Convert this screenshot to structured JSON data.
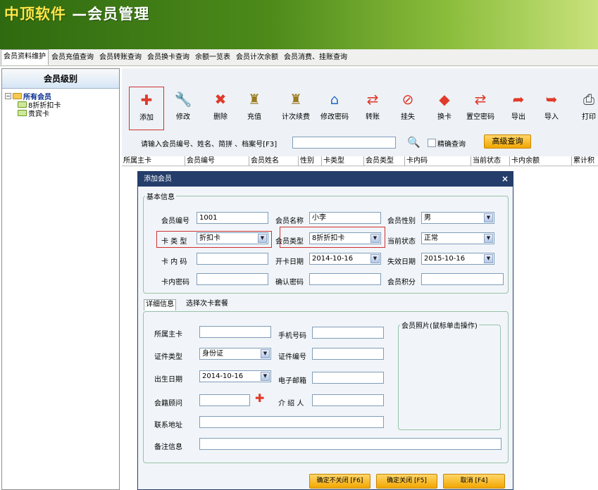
{
  "app": {
    "brand": "中顶软件",
    "subtitle": " —会员管理"
  },
  "tabs": [
    "会员资料维护",
    "会员充值查询",
    "会员转账查询",
    "会员换卡查询",
    "余额一览表",
    "会员计次余额",
    "会员消费、挂账查询"
  ],
  "left": {
    "header": "会员级别",
    "root": "所有会员",
    "children": [
      "8折折扣卡",
      "贵宾卡"
    ]
  },
  "toolbar": [
    {
      "label": "添加",
      "icon": "add-icon",
      "color": "#e03a2a",
      "glyph": "✚"
    },
    {
      "label": "修改",
      "icon": "wrench-icon",
      "color": "#7a7a7a",
      "glyph": "🔧"
    },
    {
      "label": "删除",
      "icon": "delete-icon",
      "color": "#e03a2a",
      "glyph": "✖"
    },
    {
      "label": "充值",
      "icon": "recharge-icon",
      "color": "#9a7a20",
      "glyph": "♜"
    },
    {
      "label": "计次续费",
      "icon": "renew-icon",
      "color": "#9a7a20",
      "glyph": "♜"
    },
    {
      "label": "修改密码",
      "icon": "password-icon",
      "color": "#2a70c8",
      "glyph": "⌂"
    },
    {
      "label": "转账",
      "icon": "transfer-icon",
      "color": "#e03a2a",
      "glyph": "⇄"
    },
    {
      "label": "挂失",
      "icon": "report-loss-icon",
      "color": "#e03a2a",
      "glyph": "⊘"
    },
    {
      "label": "换卡",
      "icon": "swap-card-icon",
      "color": "#e03a2a",
      "glyph": "◆"
    },
    {
      "label": "置空密码",
      "icon": "clear-password-icon",
      "color": "#e03a2a",
      "glyph": "⇄"
    },
    {
      "label": "导出",
      "icon": "export-icon",
      "color": "#e03a2a",
      "glyph": "➦"
    },
    {
      "label": "导入",
      "icon": "import-icon",
      "color": "#e03a2a",
      "glyph": "➥"
    },
    {
      "label": "打印",
      "icon": "print-icon",
      "color": "#444",
      "glyph": "⎙"
    }
  ],
  "search": {
    "hint": "请输入会员编号、姓名、简拼 、档案号[F3]",
    "value": "",
    "exact_label": "精确查询",
    "advanced_label": "高级查询"
  },
  "grid_columns": [
    "所属主卡",
    "会员编号",
    "会员姓名",
    "性别",
    "卡类型",
    "会员类型",
    "卡内码",
    "当前状态",
    "卡内余额",
    "累计积"
  ],
  "dialog": {
    "title": "添加会员",
    "basic_legend": "基本信息",
    "fields": {
      "member_no_label": "会员编号",
      "member_no": "1001",
      "member_name_label": "会员名称",
      "member_name": "小李",
      "gender_label": "会员性别",
      "gender": "男",
      "card_type_label": "卡 类 型",
      "card_type": "折扣卡",
      "member_type_label": "会员类型",
      "member_type": "8折折扣卡",
      "status_label": "当前状态",
      "status": "正常",
      "card_code_label": "卡 内 码",
      "card_code": "",
      "open_date_label": "开卡日期",
      "open_date": "2014-10-16",
      "expire_date_label": "失效日期",
      "expire_date": "2015-10-16",
      "card_pwd_label": "卡内密码",
      "card_pwd": "",
      "confirm_pwd_label": "确认密码",
      "confirm_pwd": "",
      "points_label": "会员积分",
      "points": ""
    },
    "detail_tabs": [
      "详细信息",
      "选择次卡套餐"
    ],
    "detail": {
      "main_card_label": "所属主卡",
      "main_card": "",
      "phone_label": "手机号码",
      "phone": "",
      "id_type_label": "证件类型",
      "id_type": "身份证",
      "id_no_label": "证件编号",
      "id_no": "",
      "birthday_label": "出生日期",
      "birthday": "2014-10-16",
      "email_label": "电子邮箱",
      "email": "",
      "advisor_label": "会籍顾问",
      "advisor": "",
      "referrer_label": "介 绍 人",
      "referrer": "",
      "address_label": "联系地址",
      "address": "",
      "remark_label": "备注信息",
      "remark": "",
      "photo_legend": "会员照片(鼠标单击操作)"
    },
    "buttons": {
      "confirm_keep": "确定不关闭 [F6]",
      "confirm_close": "确定关闭 [F5]",
      "cancel": "取消 [F4]"
    }
  }
}
